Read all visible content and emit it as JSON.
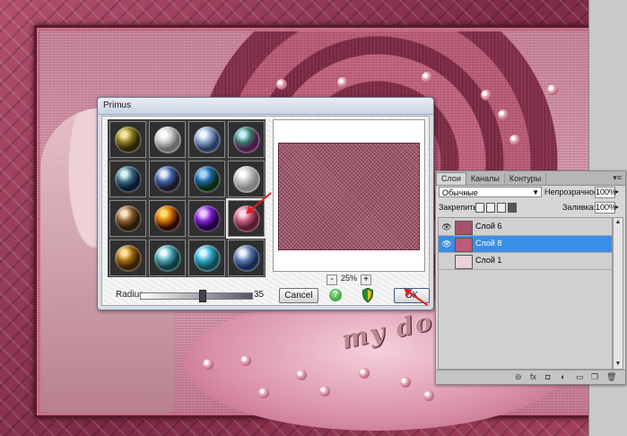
{
  "primus": {
    "title": "Primus",
    "radius_label": "Radius",
    "radius_value": "35",
    "radius_fraction": 0.55,
    "cancel_label": "Cancel",
    "ok_label": "OK",
    "zoom_value": "25%",
    "zoom_minus": "-",
    "zoom_plus": "+",
    "help_glyph": "?",
    "presets": [
      {
        "c1": "#f3e6a0",
        "c2": "#8a7a20",
        "c3": "#2a2505"
      },
      {
        "c1": "#ffffff",
        "c2": "#c8c8c8",
        "c3": "#6a6a6a"
      },
      {
        "c1": "#f4f8ff",
        "c2": "#8aa2c8",
        "c3": "#2a3a60"
      },
      {
        "c1": "#c8f0ff",
        "c2": "#3a7a6a",
        "c3": "#4a1a4a"
      },
      {
        "c1": "#d8f4f0",
        "c2": "#3a6a80",
        "c3": "#0a1a2a"
      },
      {
        "c1": "#e8ecf4",
        "c2": "#3a5fa8",
        "c3": "#1a1a2a"
      },
      {
        "c1": "#a8d8f8",
        "c2": "#1a60a0",
        "c3": "#0a2a10"
      },
      {
        "c1": "#ffffff",
        "c2": "#c0c0c0",
        "c3": "#808080"
      },
      {
        "c1": "#f8e4c8",
        "c2": "#8a5a30",
        "c3": "#2a1a08"
      },
      {
        "c1": "#ffe070",
        "c2": "#d06a00",
        "c3": "#2a0a00"
      },
      {
        "c1": "#f0c8ff",
        "c2": "#7a20d0",
        "c3": "#200040"
      },
      {
        "c1": "#ffd8e8",
        "c2": "#c05a80",
        "c3": "#5a1a30"
      },
      {
        "c1": "#ffe4a0",
        "c2": "#a06a10",
        "c3": "#3a2000"
      },
      {
        "c1": "#e8fcff",
        "c2": "#4aa0b0",
        "c3": "#103a40"
      },
      {
        "c1": "#d8f8ff",
        "c2": "#30a8c8",
        "c3": "#104a50"
      },
      {
        "c1": "#f0f4ff",
        "c2": "#5a7ab0",
        "c3": "#1a2a50"
      }
    ],
    "selected_preset": 11
  },
  "layers_panel": {
    "tabs": [
      {
        "label": "Слои",
        "active": true
      },
      {
        "label": "Каналы",
        "active": false
      },
      {
        "label": "Контуры",
        "active": false
      }
    ],
    "blend_mode": "Обычные",
    "opacity_label": "Непрозрачность:",
    "opacity_value": "100%",
    "lock_label": "Закрепить:",
    "fill_label": "Заливка:",
    "fill_value": "100%",
    "layers": [
      {
        "name": "Слой 6",
        "visible": true,
        "selected": false,
        "thumb": "#a8506a"
      },
      {
        "name": "Слой 8",
        "visible": true,
        "selected": true,
        "thumb": "#c05a78"
      },
      {
        "name": "Слой 1",
        "visible": false,
        "selected": false,
        "thumb": "#ead0d8"
      }
    ],
    "bottom_icons": [
      "link-icon",
      "fx-icon",
      "mask-icon",
      "adjustment-icon",
      "folder-icon",
      "new-layer-icon",
      "trash-icon"
    ]
  },
  "artwork": {
    "watermark": "my do"
  },
  "colors": {
    "selected_layer": "#3a8ee6",
    "arrow": "#e02020"
  }
}
